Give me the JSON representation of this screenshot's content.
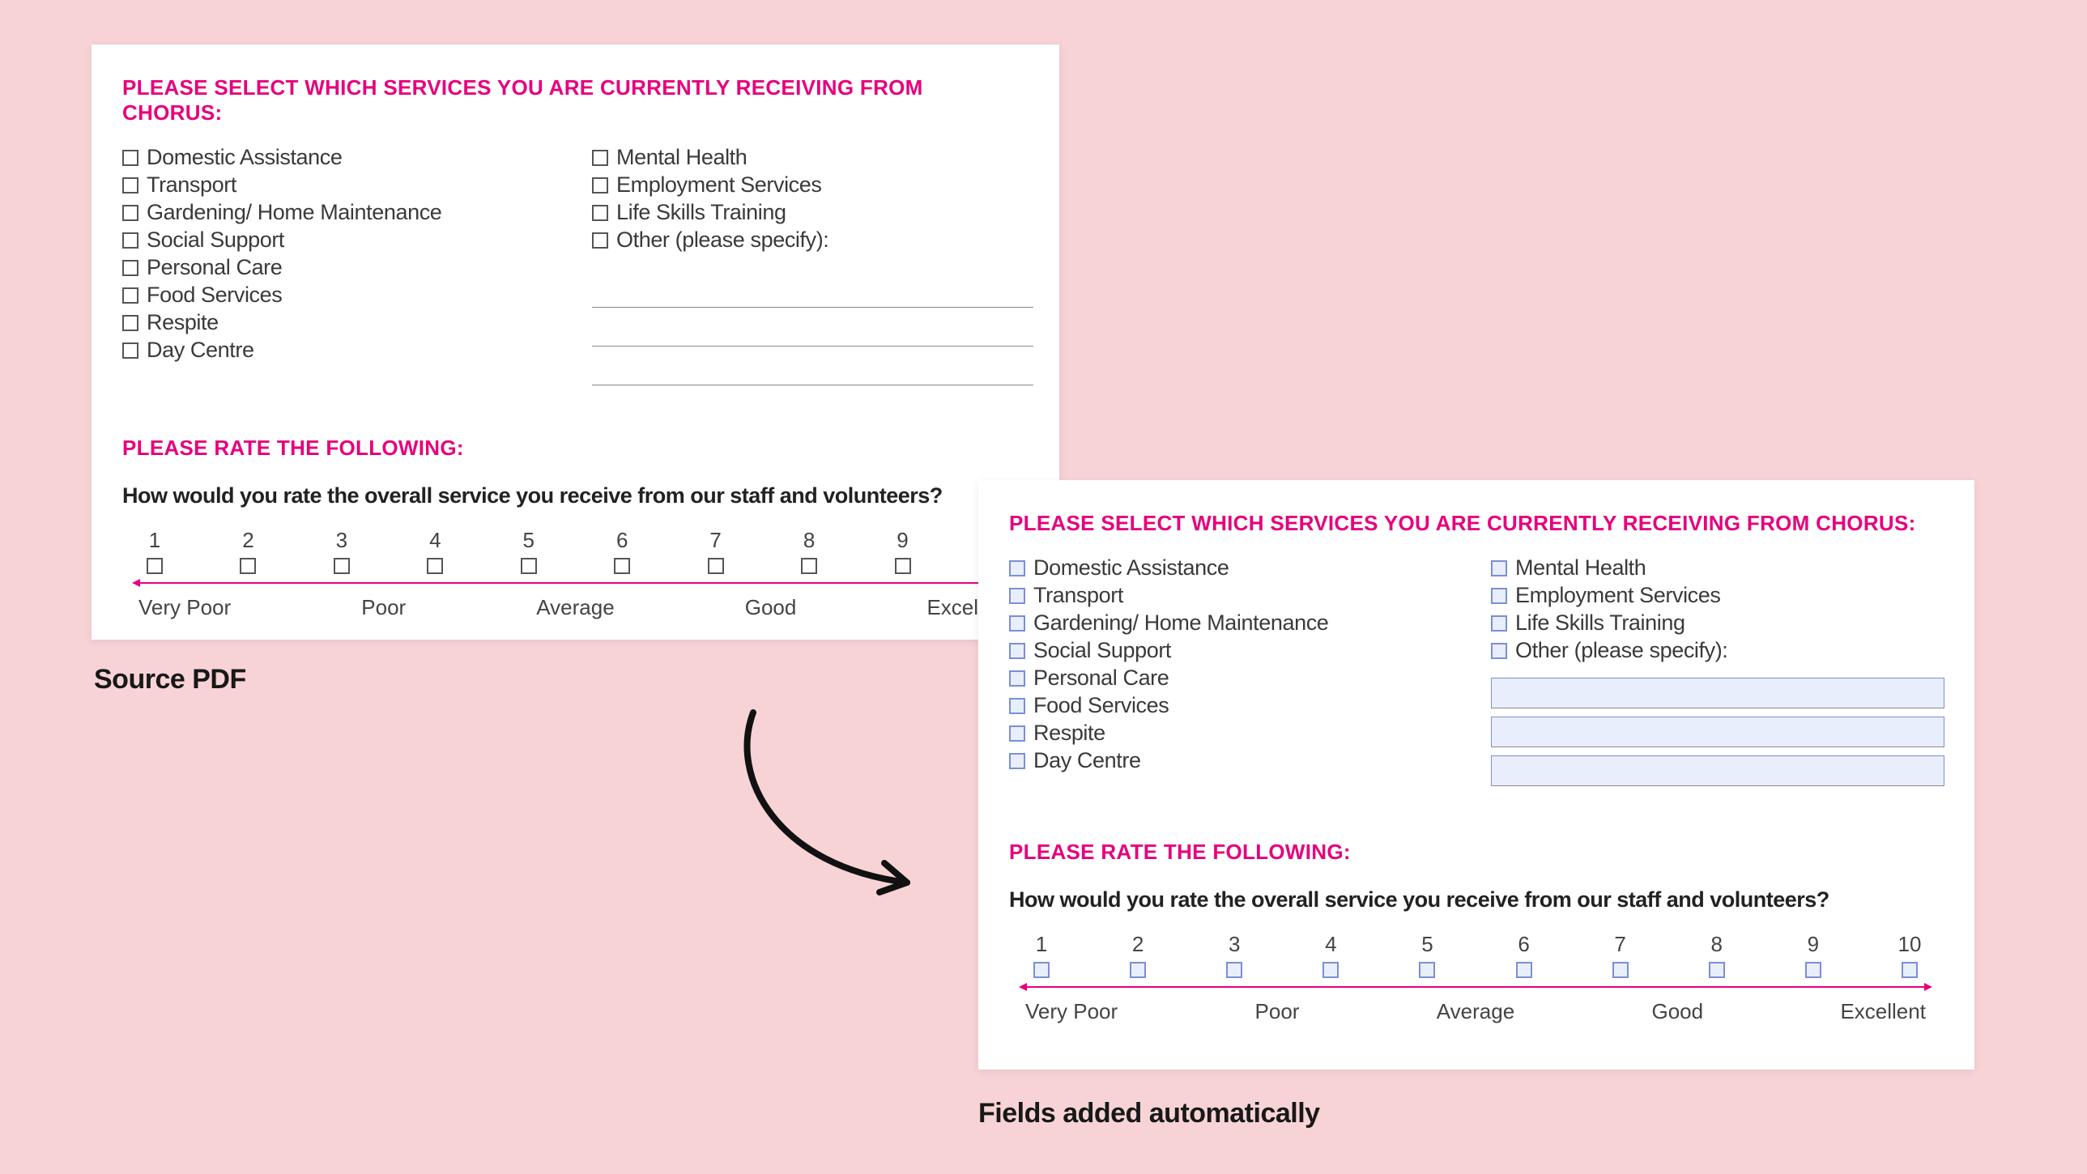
{
  "headings": {
    "services": "PLEASE SELECT WHICH SERVICES YOU ARE CURRENTLY RECEIVING FROM CHORUS:",
    "rate": "PLEASE RATE THE FOLLOWING:",
    "rate_q": "How would you rate the overall service you receive from our staff and volunteers?"
  },
  "services_col1": [
    "Domestic Assistance",
    "Transport",
    "Gardening/ Home Maintenance",
    "Social Support",
    "Personal Care",
    "Food Services",
    "Respite",
    "Day Centre"
  ],
  "services_col2": [
    "Mental Health",
    "Employment Services",
    "Life Skills Training",
    "Other (please specify):"
  ],
  "scale": {
    "nums": [
      "1",
      "2",
      "3",
      "4",
      "5",
      "6",
      "7",
      "8",
      "9",
      "10"
    ],
    "labels": [
      "Very Poor",
      "Poor",
      "Average",
      "Good",
      "Excellent"
    ]
  },
  "captions": {
    "source": "Source PDF",
    "result": "Fields added automatically"
  }
}
